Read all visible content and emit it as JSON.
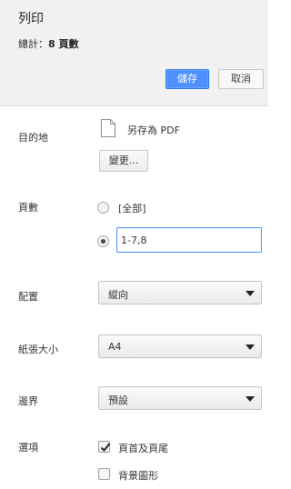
{
  "header": {
    "title": "列印",
    "summary_label": "總計：",
    "summary_value": "8 頁數",
    "save_label": "儲存",
    "cancel_label": "取消"
  },
  "destination": {
    "label": "目的地",
    "name": "另存為 PDF",
    "change_label": "變更..."
  },
  "pages": {
    "label": "頁數",
    "all_label": "[全部]",
    "custom_value": "1-7,8",
    "all_checked": false,
    "custom_checked": true
  },
  "layout": {
    "label": "配置",
    "value": "縱向"
  },
  "paper_size": {
    "label": "紙張大小",
    "value": "A4"
  },
  "margins": {
    "label": "邊界",
    "value": "預設"
  },
  "options": {
    "label": "選項",
    "items": [
      {
        "label": "頁首及頁尾",
        "checked": true
      },
      {
        "label": "背景圖形",
        "checked": false
      }
    ]
  },
  "icons": {
    "file": "file-icon",
    "select_arrow": "dropdown-arrow-icon",
    "check": "check-icon"
  },
  "colors": {
    "accent": "#4d90fe",
    "header_bg": "#f1f1f1"
  }
}
